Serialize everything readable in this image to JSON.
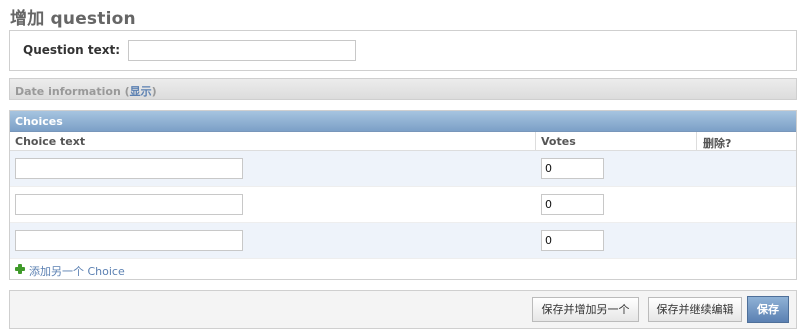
{
  "page": {
    "title": "增加 question"
  },
  "question_form": {
    "label": "Question text:",
    "value": ""
  },
  "date_section": {
    "title": "Date information",
    "open_paren": "(",
    "show_link": "显示",
    "close_paren": ")"
  },
  "choices": {
    "title": "Choices",
    "columns": {
      "choice_text": "Choice text",
      "votes": "Votes",
      "delete": "删除?"
    },
    "rows": [
      {
        "choice_text": "",
        "votes": "0"
      },
      {
        "choice_text": "",
        "votes": "0"
      },
      {
        "choice_text": "",
        "votes": "0"
      }
    ],
    "add_link": "添加另一个 Choice"
  },
  "submit": {
    "save_add_another": "保存并增加另一个",
    "save_continue": "保存并继续编辑",
    "save": "保存"
  },
  "colors": {
    "header_blue": "#7ca0c7",
    "link_blue": "#5b80b2",
    "row_alt": "#eef3fa",
    "add_green": "#3f9a2a"
  }
}
